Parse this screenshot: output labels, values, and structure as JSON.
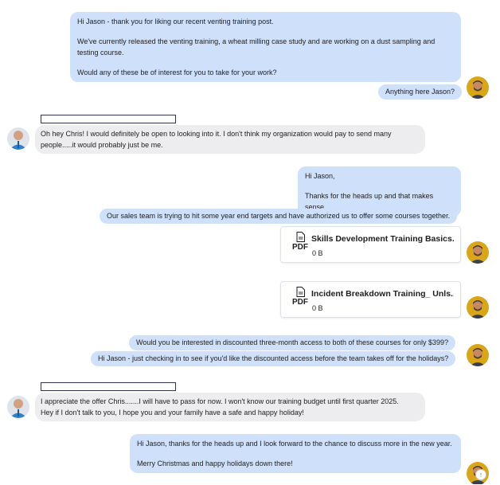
{
  "conversation": {
    "messages": [
      {
        "paragraphs": [
          "Hi Jason - thank you for liking our recent venting training post.",
          "We've currently released the venting training, a wheat milling case study and are working on a dust sampling and testing course.",
          "Would any of these be of interest for you to take for your work?"
        ]
      },
      {
        "text": "Anything here Jason?"
      },
      {
        "text": "Oh hey Chris! I would definitely be open to looking into it. I don't think my organization would pay to send many people.....it would probably just be me."
      },
      {
        "paragraphs": [
          "Hi Jason,",
          "Thanks for the heads up and that makes sense"
        ]
      },
      {
        "text": "Our sales team is trying to hit some year end targets and have authorized us to offer some courses together."
      },
      {
        "text": "Would you be interested in discounted three-month access to both of these courses for only $399?"
      },
      {
        "text": "Hi Jason - just checking in to see if you'd like the discounted access before the team takes off for the holidays?"
      },
      {
        "lines": [
          "I appreciate the offer Chris.......I will have to pass for now. I won't know our training budget until first quarter 2025.",
          "Hey if I don't talk to you, I hope you and your family have a safe and happy holiday!"
        ]
      },
      {
        "paragraphs": [
          "Hi Jason, thanks for the heads up and I look forward to the chance to discuss more in the new year.",
          "Merry Christmas and happy holidays down there!"
        ]
      }
    ],
    "attachments": [
      {
        "name": "Skills Development Training Basics...",
        "type_label": "PDF",
        "size": "0 B",
        "icon": "document-icon"
      },
      {
        "name": "Incident Breakdown Training_ Unls...",
        "type_label": "PDF",
        "size": "0 B",
        "icon": "document-icon"
      }
    ],
    "scroll_button": {
      "glyph": "↑",
      "icon": "arrow-up-icon"
    }
  },
  "colors": {
    "outgoing_bubble": "#cfe0fb",
    "incoming_bubble": "#ededf0",
    "name_box_border": "#33334d"
  }
}
